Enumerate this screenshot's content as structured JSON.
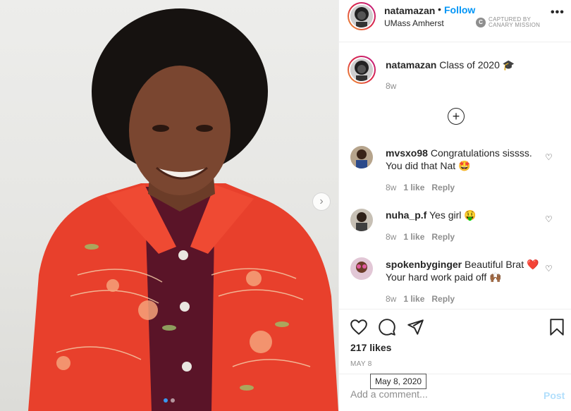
{
  "post": {
    "username": "natamazan",
    "follow_dot": "•",
    "follow_label": "Follow",
    "location": "UMass Amherst",
    "watermark": "CAPTURED BY CANARY MISSION",
    "more_label": "•••"
  },
  "caption": {
    "username": "natamazan",
    "text": "Class of 2020 🎓",
    "age": "8w"
  },
  "load_more_label": "+",
  "comments": [
    {
      "username": "mvsxo98",
      "text": "Congratulations sissss. You did that Nat 🤩",
      "age": "8w",
      "likes": "1 like",
      "reply": "Reply"
    },
    {
      "username": "nuha_p.f",
      "text": "Yes girl 🤑",
      "age": "8w",
      "likes": "1 like",
      "reply": "Reply"
    },
    {
      "username": "spokenbyginger",
      "text": "Beautiful Brat ❤️ Your hard work paid off 🙌🏾",
      "age": "8w",
      "likes": "1 like",
      "reply": "Reply"
    }
  ],
  "actions": {
    "likes": "217 likes",
    "date": "MAY 8",
    "date_tooltip": "May 8, 2020"
  },
  "add_comment": {
    "placeholder": "Add a comment...",
    "post_label": "Post"
  },
  "icons": {
    "like": "heart-icon",
    "comment": "comment-icon",
    "share": "paper-plane-icon",
    "save": "bookmark-icon",
    "next": "chevron-right-icon",
    "more": "more-options-icon"
  },
  "colors": {
    "accent": "#0095f6",
    "post_disabled": "#b2dffc",
    "muted": "#8e8e8e",
    "jacket": "#e8402c",
    "carousel_active": "#3897f0"
  },
  "carousel": {
    "index": 1,
    "count": 2
  }
}
